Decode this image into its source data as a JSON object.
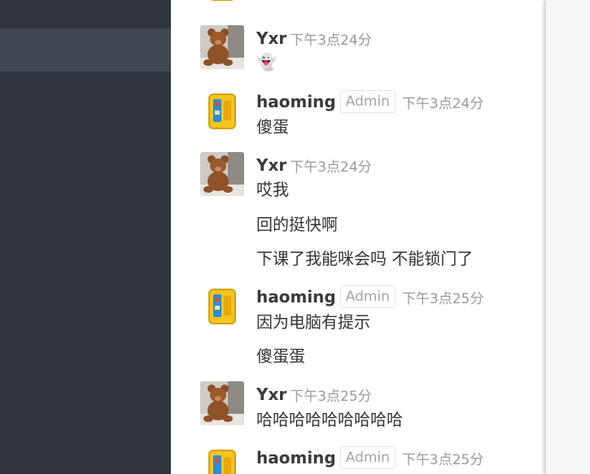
{
  "messages": [
    {
      "user": "Yxr",
      "badge": "",
      "time": "下午3点24分",
      "avatar": "teddy-bear",
      "lines": [
        "👻"
      ]
    },
    {
      "user": "haoming",
      "badge": "Admin",
      "time": "下午3点24分",
      "avatar": "yellow-box",
      "lines": [
        "傻蛋"
      ]
    },
    {
      "user": "Yxr",
      "badge": "",
      "time": "下午3点24分",
      "avatar": "teddy-bear",
      "lines": [
        "哎我",
        "回的挺快啊",
        "下课了我能咪会吗 不能锁门了"
      ]
    },
    {
      "user": "haoming",
      "badge": "Admin",
      "time": "下午3点25分",
      "avatar": "yellow-box",
      "lines": [
        "因为电脑有提示",
        "傻蛋蛋"
      ]
    },
    {
      "user": "Yxr",
      "badge": "",
      "time": "下午3点25分",
      "avatar": "teddy-bear",
      "lines": [
        "哈哈哈哈哈哈哈哈哈"
      ]
    },
    {
      "user": "haoming",
      "badge": "Admin",
      "time": "下午3点25分",
      "avatar": "yellow-box",
      "lines": []
    }
  ],
  "colors": {
    "sidebar": "#2f343d",
    "sidebar_active": "#414852",
    "chat_bg": "#ffffff",
    "username": "#3a3a3a",
    "time": "#9a9a9a"
  }
}
